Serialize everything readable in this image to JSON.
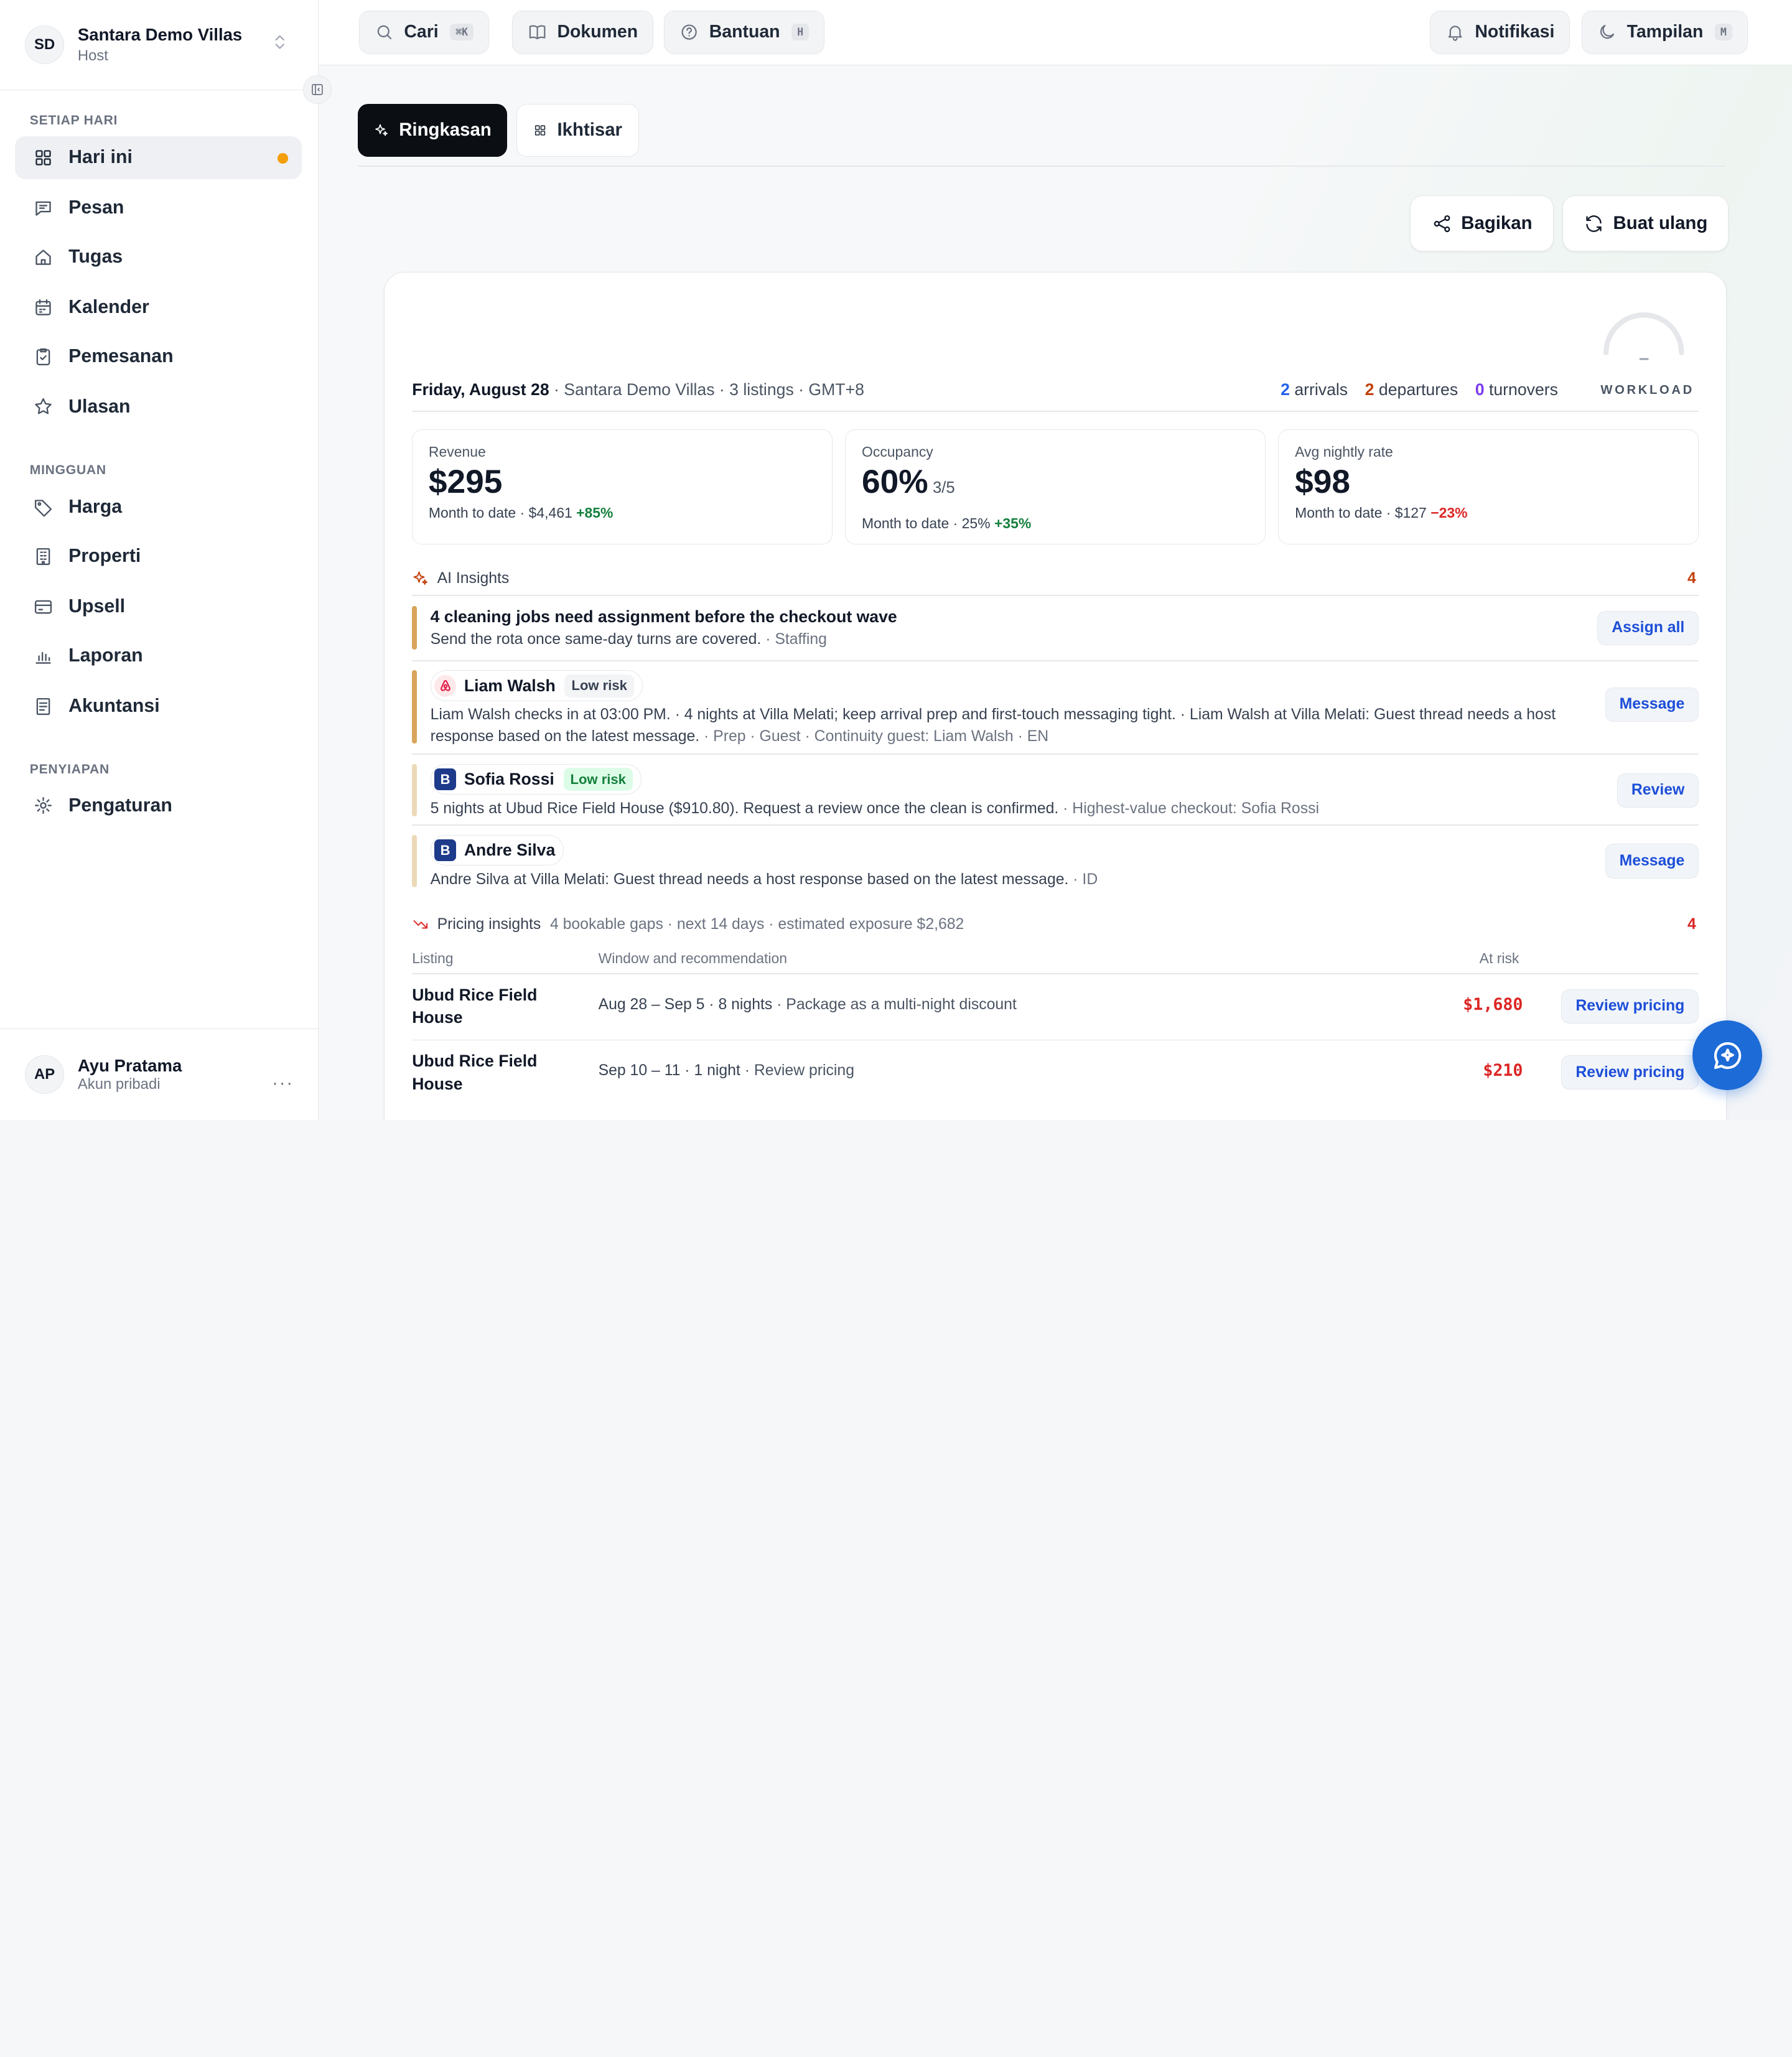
{
  "workspace": {
    "initials": "SD",
    "name": "Santara Demo Villas",
    "role": "Host"
  },
  "sidebar": {
    "sections": [
      {
        "title": "SETIAP HARI",
        "items": [
          {
            "label": "Hari ini",
            "icon": "grid-icon",
            "active": true
          },
          {
            "label": "Pesan",
            "icon": "message-icon"
          },
          {
            "label": "Tugas",
            "icon": "home-icon"
          },
          {
            "label": "Kalender",
            "icon": "calendar-icon"
          },
          {
            "label": "Pemesanan",
            "icon": "clipboard-check-icon"
          },
          {
            "label": "Ulasan",
            "icon": "star-icon"
          }
        ]
      },
      {
        "title": "MINGGUAN",
        "items": [
          {
            "label": "Harga",
            "icon": "tag-icon"
          },
          {
            "label": "Properti",
            "icon": "building-icon"
          },
          {
            "label": "Upsell",
            "icon": "card-icon"
          },
          {
            "label": "Laporan",
            "icon": "bar-chart-icon"
          },
          {
            "label": "Akuntansi",
            "icon": "ledger-icon"
          }
        ]
      },
      {
        "title": "PENYIAPAN",
        "items": [
          {
            "label": "Pengaturan",
            "icon": "gear-icon"
          }
        ]
      }
    ]
  },
  "user": {
    "initials": "AP",
    "name": "Ayu Pratama",
    "account": "Akun pribadi",
    "more": "···"
  },
  "topbar": {
    "search": {
      "label": "Cari",
      "kbd": "⌘K"
    },
    "docs": {
      "label": "Dokumen"
    },
    "help": {
      "label": "Bantuan",
      "kbd": "H"
    },
    "notifications": {
      "label": "Notifikasi"
    },
    "appearance": {
      "label": "Tampilan",
      "kbd": "M"
    }
  },
  "tabs": {
    "summary": "Ringkasan",
    "overview": "Ikhtisar"
  },
  "actions": {
    "share": "Bagikan",
    "regenerate": "Buat ulang"
  },
  "summary": {
    "date": "Friday, August 28",
    "meta": " · Santara Demo Villas · 3 listings · GMT+8",
    "arrivals": {
      "n": "2",
      "label": "arrivals",
      "color": "#2563eb"
    },
    "departures": {
      "n": "2",
      "label": "departures",
      "color": "#c2410c"
    },
    "turnovers": {
      "n": "0",
      "label": "turnovers",
      "color": "#7c3aed"
    },
    "workload_label": "WORKLOAD",
    "workload_value": "–"
  },
  "stats": [
    {
      "label": "Revenue",
      "value": "$295",
      "suffix": "",
      "sub": "Month to date · $4,461",
      "delta": "+85%",
      "delta_dir": "pos"
    },
    {
      "label": "Occupancy",
      "value": "60%",
      "suffix": "3/5",
      "sub": "Month to date · 25%",
      "delta": "+35%",
      "delta_dir": "pos"
    },
    {
      "label": "Avg nightly rate",
      "value": "$98",
      "suffix": "",
      "sub": "Month to date · $127",
      "delta": "−23%",
      "delta_dir": "neg"
    }
  ],
  "ai_insights": {
    "title": "AI Insights",
    "count": "4",
    "items": [
      {
        "title": "4 cleaning jobs need assignment before the checkout wave",
        "desc": "Send the rota once same-day turns are covered.",
        "meta": " · Staffing",
        "button": "Assign all",
        "bar_color": "#d9a55b"
      },
      {
        "guest": "Liam Walsh",
        "channel": "airbnb",
        "risk": "Low risk",
        "desc": "Liam Walsh checks in at 03:00 PM. · 4 nights at Villa Melati; keep arrival prep and first-touch messaging tight. · Liam Walsh at Villa Melati: Guest thread needs a host response based on the latest message.",
        "meta": " · Prep · Guest · Continuity guest: Liam Walsh · EN",
        "button": "Message",
        "bar_color": "#d9a55b"
      },
      {
        "guest": "Sofia Rossi",
        "channel": "booking",
        "channel_letter": "B",
        "risk": "Low risk",
        "desc": "5 nights at Ubud Rice Field House ($910.80). Request a review once the clean is confirmed.",
        "meta": " · Highest-value checkout: Sofia Rossi",
        "button": "Review",
        "bar_color": "#ecd9b8"
      },
      {
        "guest": "Andre Silva",
        "channel": "booking",
        "channel_letter": "B",
        "desc": "Andre Silva at Villa Melati: Guest thread needs a host response based on the latest message.",
        "meta": " · ID",
        "button": "Message",
        "bar_color": "#ecd9b8"
      }
    ]
  },
  "pricing": {
    "title": "Pricing insights",
    "summary": "4 bookable gaps · next 14 days · estimated exposure $2,682",
    "count": "4",
    "columns": [
      "Listing",
      "Window and recommendation",
      "At risk"
    ],
    "rows": [
      {
        "listing": "Ubud Rice Field House",
        "window": "Aug 28 – Sep 5 · 8 nights",
        "rec": " · Package as a multi-night discount",
        "at_risk": "$1,680",
        "button": "Review pricing"
      },
      {
        "listing": "Ubud Rice Field House",
        "window": "Sep 10 – 11 · 1 night",
        "rec": " · Review pricing",
        "at_risk": "$210",
        "button": "Review pricing"
      }
    ]
  }
}
